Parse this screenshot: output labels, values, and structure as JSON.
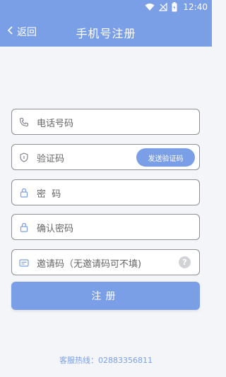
{
  "status": {
    "time": "12:40"
  },
  "nav": {
    "back_label": "返回",
    "title": "手机号注册"
  },
  "form": {
    "phone_placeholder": "电话号码",
    "code_placeholder": "验证码",
    "send_code_label": "发送验证码",
    "password_placeholder": "密  码",
    "confirm_placeholder": "确认密码",
    "invite_placeholder": "邀请码（无邀请码可不填)",
    "help_icon": "?"
  },
  "register_label": "注册",
  "hotline": "客服热线：02883356811",
  "colors": {
    "accent": "#7b9fe6",
    "background": "#f4f5f9",
    "border": "#8d8f97"
  },
  "icons": [
    "wifi-icon",
    "signal-icon",
    "battery-icon",
    "back-arrow-icon",
    "phone-icon",
    "shield-icon",
    "lock-icon",
    "invite-card-icon",
    "help-icon"
  ]
}
